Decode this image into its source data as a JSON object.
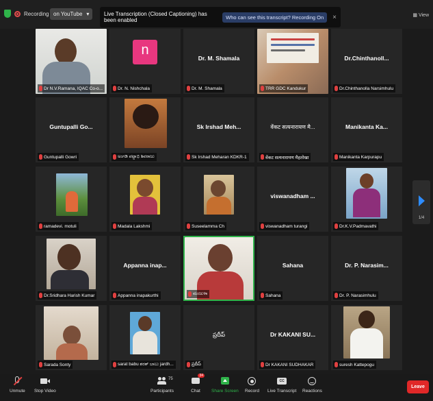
{
  "topbar": {
    "recording": "Recording",
    "live_button": "on YouTube",
    "live_caret": "▾",
    "view": "View",
    "banner_text": "Live Transcription (Closed Captioning) has been enabled",
    "banner_who": "Who can see this transcript? Recording On",
    "banner_close": "×"
  },
  "tiles": [
    {
      "name": "Dr N.V.Ramana, IQAC Co-o...",
      "display": ""
    },
    {
      "name": "Dr. N. Nishchala",
      "display": "n"
    },
    {
      "name": "Dr. M. Shamala",
      "display": "Dr. M. Shamala"
    },
    {
      "name": "TRR GDC Kandukur",
      "display": ""
    },
    {
      "name": "Dr.Chinthanolla Narsimhulu",
      "display": "Dr.Chinthanoll..."
    },
    {
      "name": "Guntupalli Gowri",
      "display": "Guntupalli Go..."
    },
    {
      "name": "ಅಂಗಡಿ ಪಟ್ಟಾಭಿ ಶಿವರಾಜು",
      "display": ""
    },
    {
      "name": "Sk Irshad Meharan KDKR-1",
      "display": "Sk Irshad Meh..."
    },
    {
      "name": "वेंकट सत्यनारायण मैहतोखा",
      "display": "वेंकट सत्यनारायण मै..."
    },
    {
      "name": "Manikanta Karpurapu",
      "display": "Manikanta Ka..."
    },
    {
      "name": "ramadevi. motuli",
      "display": ""
    },
    {
      "name": "Madala Lakshmi",
      "display": ""
    },
    {
      "name": "Suseelamma Ch",
      "display": ""
    },
    {
      "name": "viswanadham turangi",
      "display": "viswanadham ..."
    },
    {
      "name": "Dr.K.V.Padmavathi",
      "display": ""
    },
    {
      "name": "Dr.Sridhara Harish Kumar",
      "display": ""
    },
    {
      "name": "Appanna inapakurthi",
      "display": "Appanna inap..."
    },
    {
      "name": "ಮಂಜುಳಾ",
      "display": ""
    },
    {
      "name": "Sahana",
      "display": "Sahana"
    },
    {
      "name": "Dr. P. Narasimhulu",
      "display": "Dr. P. Narasim..."
    },
    {
      "name": "Sarada Sonty",
      "display": ""
    },
    {
      "name": "sarat babu ಶರತ್ ಬಾಬು jardh...",
      "display": ""
    },
    {
      "name": "ప్రదీప్",
      "display": "ప్రదీప్"
    },
    {
      "name": "Dr KAKANI SUDHAKAR",
      "display": "Dr KAKANI SU..."
    },
    {
      "name": "suresh Kattepogu",
      "display": ""
    }
  ],
  "pager": "1/4",
  "toolbar": {
    "unmute": "Unmute",
    "stop_video": "Stop Video",
    "participants": "Participants",
    "participants_count": "75",
    "chat": "Chat",
    "chat_badge": "34",
    "share": "Share Screen",
    "record": "Record",
    "live_transcript": "Live Transcript",
    "reactions": "Reactions",
    "leave": "Leave"
  },
  "colors": {
    "accent": "#2d8cff",
    "leave": "#e02828",
    "share": "#2fb34a",
    "tile_bg": "#262626"
  }
}
